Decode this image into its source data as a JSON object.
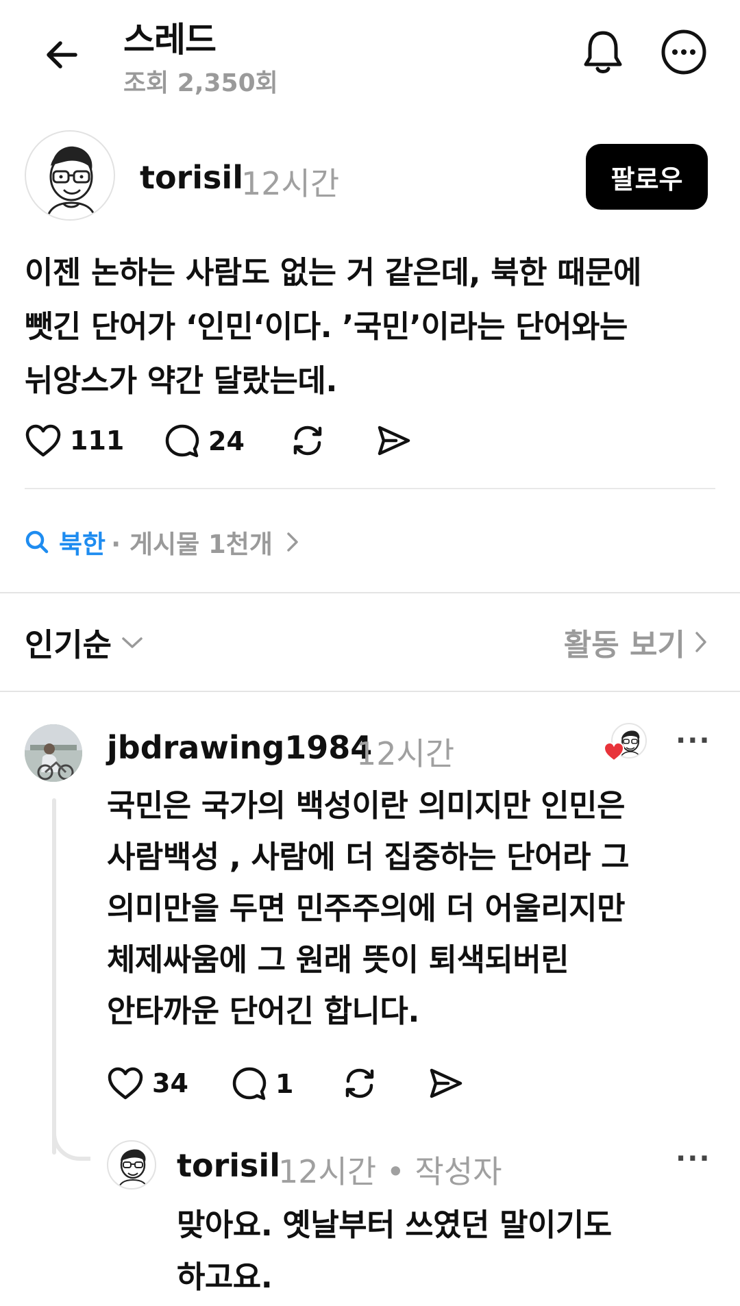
{
  "header": {
    "title": "스레드",
    "views": "조회 2,350회",
    "icons": {
      "back": "back-arrow-icon",
      "notify": "bell-icon",
      "more": "more-options-icon"
    }
  },
  "post": {
    "author": "torisil",
    "time": "12시간",
    "follow_label": "팔로우",
    "lines": [
      "이젠 논하는 사람도 없는 거 같은데, 북한 때문에",
      "뺏긴 단어가 ‘인민‘이다. ’국민’이라는 단어와는",
      "뉘앙스가 약간 달랐는데."
    ],
    "likes": "111",
    "comments": "24"
  },
  "topic": {
    "name": "북한",
    "count": "· 게시물 1천개"
  },
  "sort": {
    "label": "인기순",
    "activity_label": "활동 보기"
  },
  "replies": [
    {
      "author": "jbdrawing1984",
      "time": "12시간",
      "lines": [
        "국민은 국가의 백성이란 의미지만 인민은",
        "사람백성 , 사람에 더 집중하는 단어라 그",
        "의미만을 두면 민주주의에 더 어울리지만",
        "체제싸움에 그 원래 뜻이 퇴색되버린",
        "안타까운 단어긴 합니다."
      ],
      "likes": "34",
      "comments": "1",
      "more": "···"
    },
    {
      "author": "torisil",
      "meta": "12시간 • 작성자",
      "lines": [
        "맞아요. 옛날부터 쓰였던 말이기도",
        "하고요."
      ],
      "more": "···"
    }
  ],
  "colors": {
    "accent": "#1e8cf0",
    "muted": "#9a9a9a",
    "like_red": "#e8333a"
  }
}
